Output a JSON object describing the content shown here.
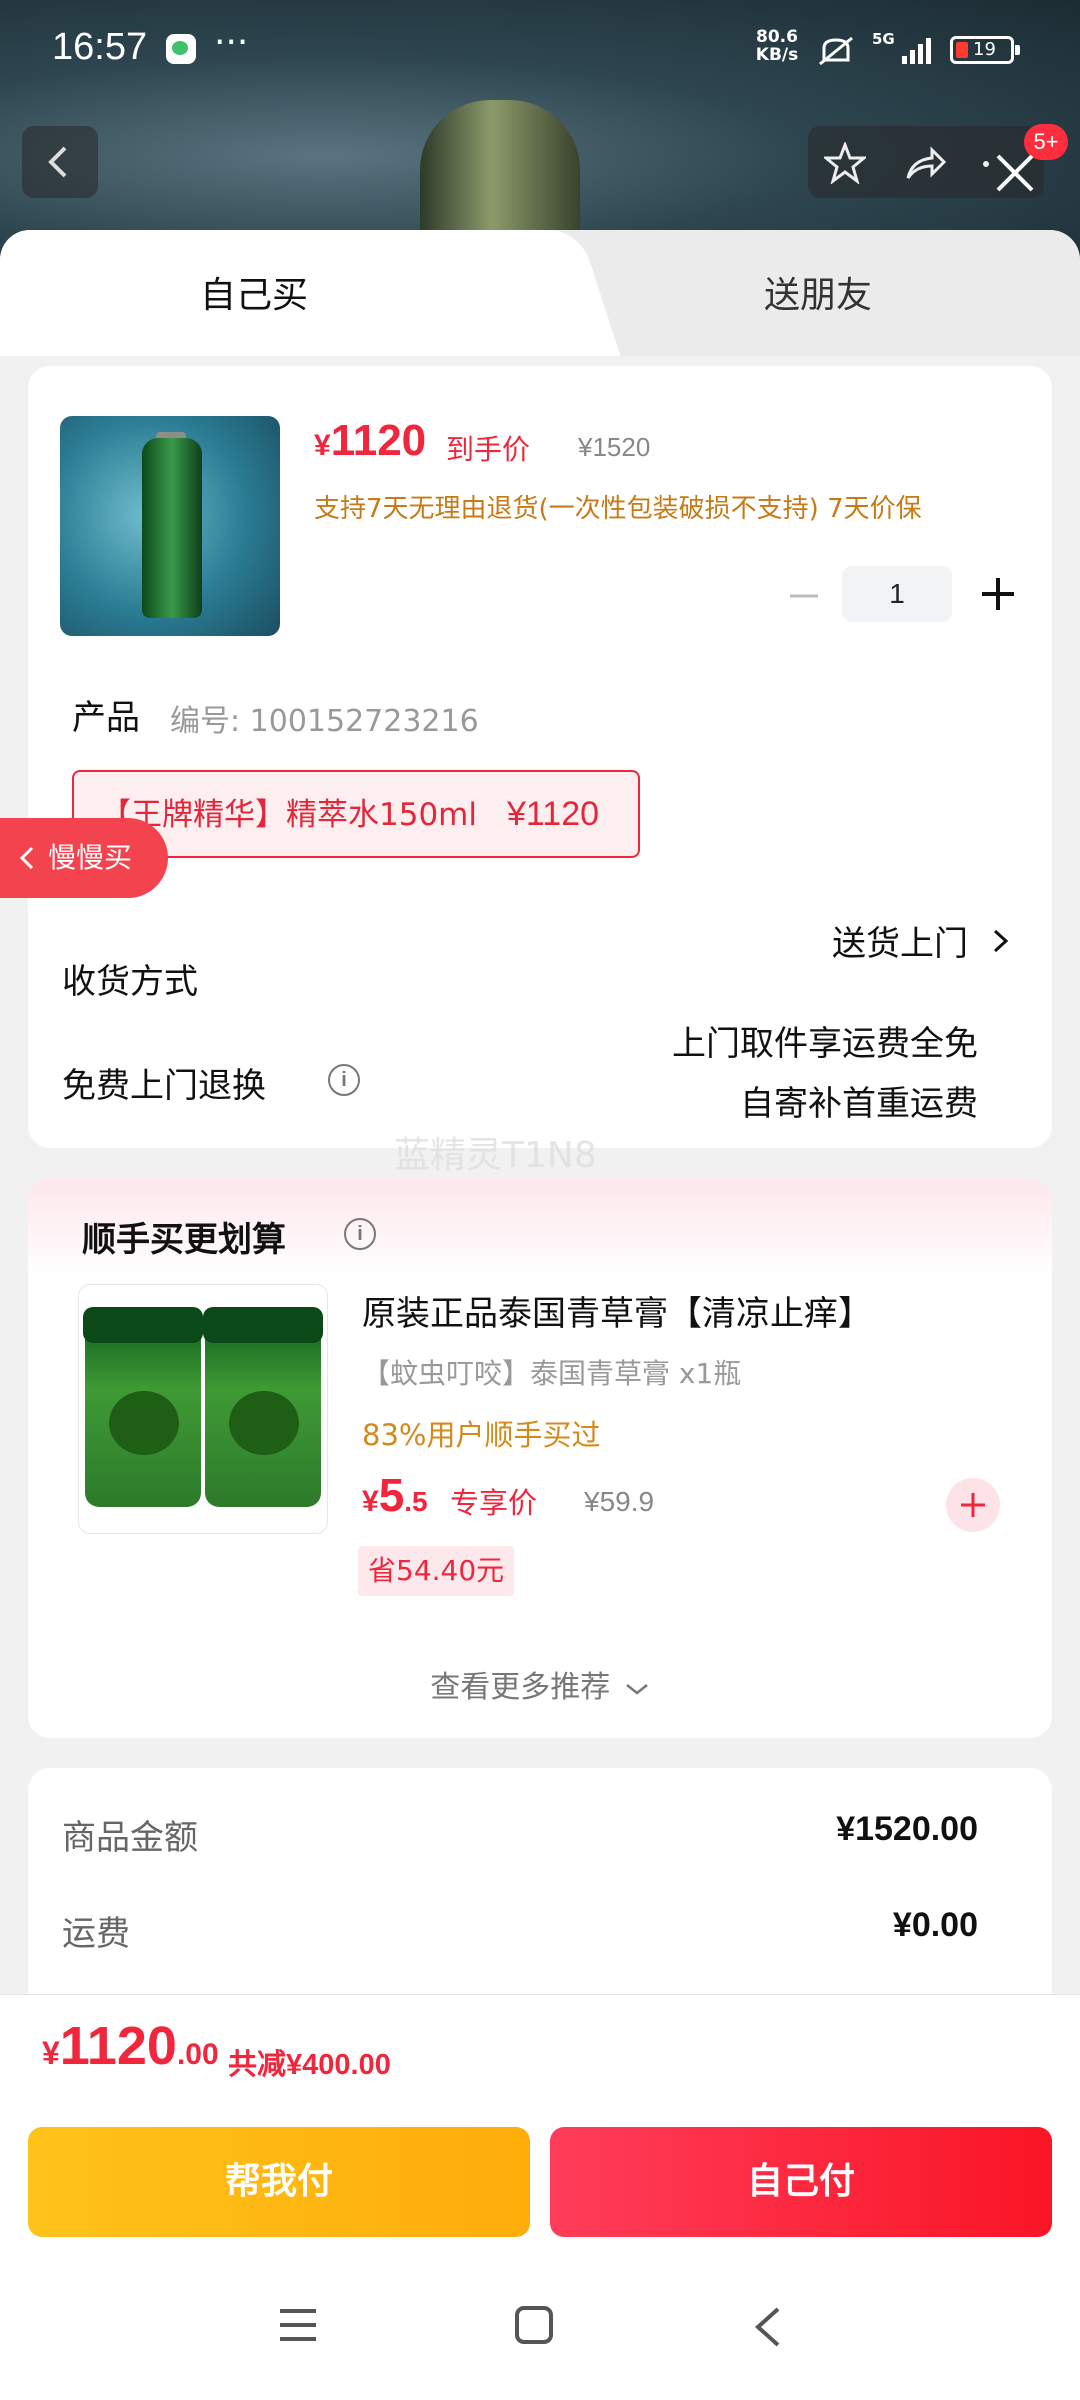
{
  "status_bar": {
    "time": "16:57",
    "dots": "···",
    "net_speed_value": "80.6",
    "net_speed_unit": "KB/s",
    "signal": "5G",
    "battery": "19"
  },
  "header": {
    "badge": "5+"
  },
  "tabs": [
    {
      "label": "自己买"
    },
    {
      "label": "送朋友"
    }
  ],
  "product": {
    "price_yen": "¥",
    "price": "1120",
    "price_tag": "到手价",
    "original_price": "¥1520",
    "return_note": "支持7天无理由退货(一次性包装破损不支持) 7天价保",
    "quantity": "1"
  },
  "spec": {
    "label": "产品",
    "code": "编号: 100152723216",
    "sku_name": "【王牌精华】精萃水150ml",
    "sku_price": "¥1120"
  },
  "slow_buy": {
    "label": "慢慢买"
  },
  "delivery": {
    "label": "收货方式",
    "value": "送货上门"
  },
  "free_return": {
    "label": "免费上门退换",
    "line1": "上门取件享运费全免",
    "line2": "自寄补首重运费"
  },
  "watermark": "蓝精灵T1N8",
  "recommend": {
    "title": "顺手买更划算",
    "name": "原装正品泰国青草膏【清凉止痒】",
    "sku": "【蚊虫叮咬】泰国青草膏 x1瓶",
    "ratio": "83%用户顺手买过",
    "price_yen": "¥",
    "price_int": "5",
    "price_dec": ".5",
    "price_tag": "专享价",
    "original_price": "¥59.9",
    "save": "省54.40元",
    "more": "查看更多推荐"
  },
  "summary": {
    "rows": [
      {
        "label": "商品金额",
        "value": "¥1520.00"
      },
      {
        "label": "运费",
        "value": "¥0.00"
      }
    ]
  },
  "checkout": {
    "total_yen": "¥",
    "total_int": "1120",
    "total_dec": ".00",
    "discount": "共减¥400.00",
    "help_pay": "帮我付",
    "self_pay": "自己付"
  },
  "colors": {
    "accent_red": "#f0263d",
    "help_yellow": "#ffb812",
    "note_orange": "#c77a15"
  },
  "icons": [
    "back-arrow-icon",
    "star-icon",
    "share-icon",
    "more-icon",
    "close-icon",
    "minus-icon",
    "plus-icon",
    "chevron-right-icon",
    "info-icon",
    "add-icon",
    "menu-icon",
    "home-icon",
    "back-icon"
  ]
}
